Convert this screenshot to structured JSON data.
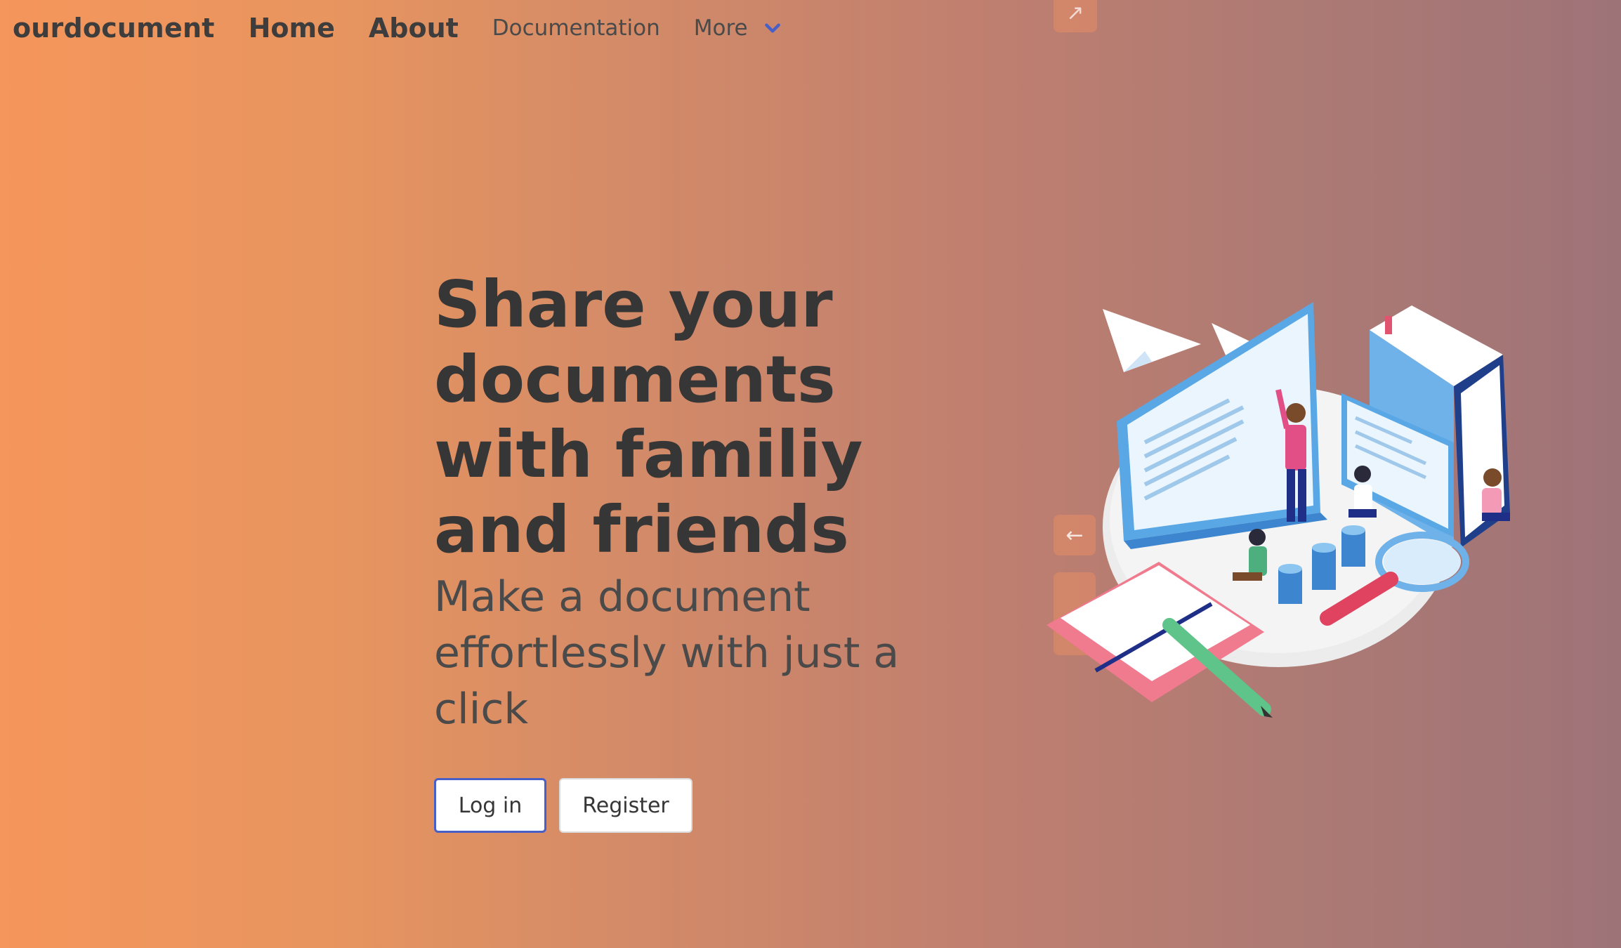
{
  "nav": {
    "brand": "ourdocument",
    "home": "Home",
    "about": "About",
    "documentation": "Documentation",
    "more": "More",
    "more_icon": "chevron-down-icon",
    "accent": "#485fc7"
  },
  "hero": {
    "title": "Share your documents with familiy and friends",
    "subtitle": "Make a document effortlessly with just a click"
  },
  "buttons": {
    "login": "Log in",
    "register": "Register"
  },
  "icons": {
    "top_chip": "external-link-arrow-icon",
    "mid_chip": "left-arrow-icon",
    "illustration": "isometric-document-sharing-illustration"
  },
  "colors": {
    "gradient_start": "#f5965c",
    "gradient_end": "#9e7378",
    "text": "#363636"
  }
}
